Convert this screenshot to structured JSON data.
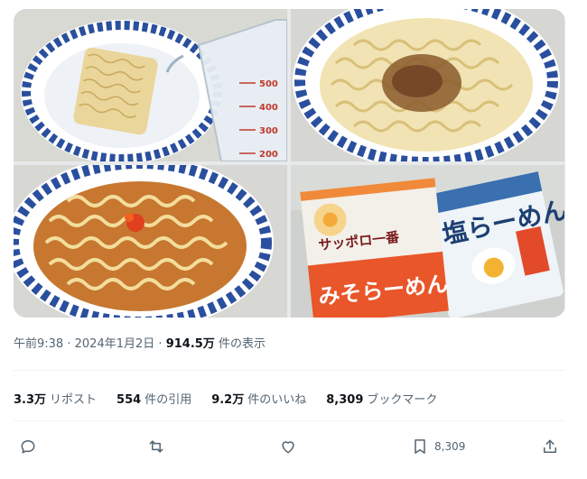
{
  "media": {
    "photos": [
      {
        "name": "photo-noodles-water"
      },
      {
        "name": "photo-noodles-topping"
      },
      {
        "name": "photo-noodles-soup"
      },
      {
        "name": "photo-packages"
      }
    ],
    "cup_marks": [
      "500",
      "400",
      "300",
      "200"
    ],
    "package_labels": {
      "left_brand": "サッポロ一番",
      "left_flavor": "みそらーめん",
      "right_flavor": "塩らーめん"
    }
  },
  "meta": {
    "time": "午前9:38",
    "separator": "·",
    "date": "2024年1月2日",
    "views_num": "914.5万",
    "views_label": "件の表示"
  },
  "stats": {
    "reposts_num": "3.3万",
    "reposts_label": "リポスト",
    "quotes_num": "554",
    "quotes_label": "件の引用",
    "likes_num": "9.2万",
    "likes_label": "件のいいね",
    "bookmarks_num": "8,309",
    "bookmarks_label": "ブックマーク"
  },
  "actions": {
    "reply_icon": "reply-icon",
    "repost_icon": "repost-icon",
    "like_icon": "heart-icon",
    "bookmark_icon": "bookmark-icon",
    "bookmark_count": "8,309",
    "share_icon": "share-icon"
  }
}
